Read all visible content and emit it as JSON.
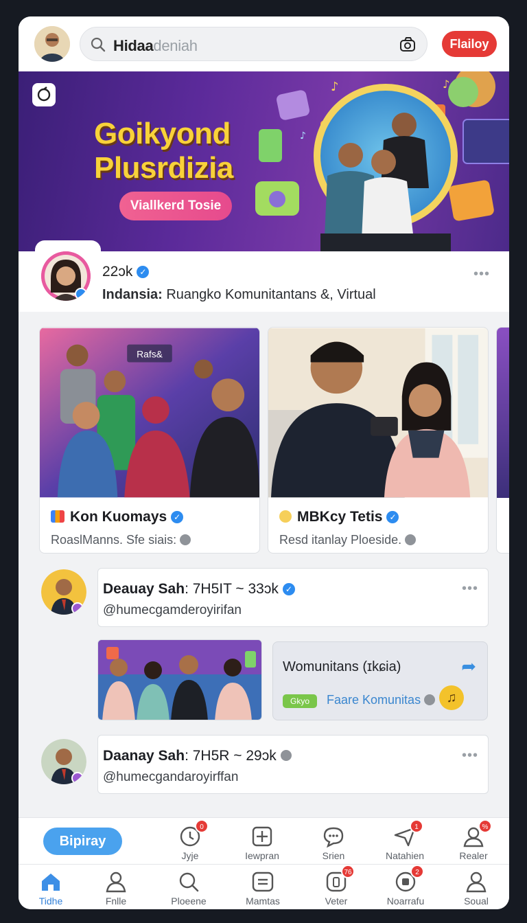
{
  "header": {
    "search_value_bold": "Hidaa",
    "search_value_light": "deniah",
    "follow_label": "Flailoy"
  },
  "banner": {
    "title_line1": "Goikyond",
    "title_line2": "Plusrdizia",
    "button_label": "Viallkerd Tosie"
  },
  "profile": {
    "count": "22ɔk",
    "desc_bold": "Indansia:",
    "desc_rest": " Ruangko Komunitantans &, Virtual"
  },
  "cards": [
    {
      "title": "Kon Kuomays",
      "subtitle": "RoaslManns. Sfe siais:",
      "image_sign": "Rafs&"
    },
    {
      "title": "MBKcy Tetis",
      "subtitle": "Resd itanlay Ploeside."
    }
  ],
  "comments": [
    {
      "name": "Deauay Sah",
      "meta": ": 7H5IT ~ 33ɔk",
      "handle": "@humecgamderoyirifan"
    },
    {
      "name": "Daanay Sah",
      "meta": ": 7H5R ~ 29ɔk",
      "handle": "@humecgandaroyirffan"
    }
  ],
  "share_card": {
    "title": "Womunitans (ɪkɕia)",
    "tag": "Gkyo",
    "link": "Faare Komunitas"
  },
  "action_bar": {
    "primary": "Bipiray",
    "items": [
      {
        "label": "Jyje",
        "icon": "clock-icon",
        "badge": "0"
      },
      {
        "label": "Iewpran",
        "icon": "grid-icon"
      },
      {
        "label": "Srien",
        "icon": "chat-icon"
      },
      {
        "label": "Natahien",
        "icon": "send-icon",
        "badge": "1"
      },
      {
        "label": "Realer",
        "icon": "user-icon",
        "badge": "%"
      }
    ]
  },
  "nav": {
    "items": [
      {
        "label": "Tidhe",
        "icon": "home-icon",
        "active": true
      },
      {
        "label": "Fnlle",
        "icon": "person-icon"
      },
      {
        "label": "Ploeene",
        "icon": "search-icon"
      },
      {
        "label": "Mamtas",
        "icon": "menu-icon"
      },
      {
        "label": "Veter",
        "icon": "phone-icon",
        "badge": "76"
      },
      {
        "label": "Noarrafu",
        "icon": "record-icon",
        "badge": "2"
      },
      {
        "label": "Soual",
        "icon": "account-icon"
      }
    ]
  },
  "colors": {
    "accent_blue": "#2f7fd8",
    "follow_red": "#e53a36",
    "banner_purple": "#5b2a9a",
    "banner_title_yellow": "#f8d23a"
  }
}
